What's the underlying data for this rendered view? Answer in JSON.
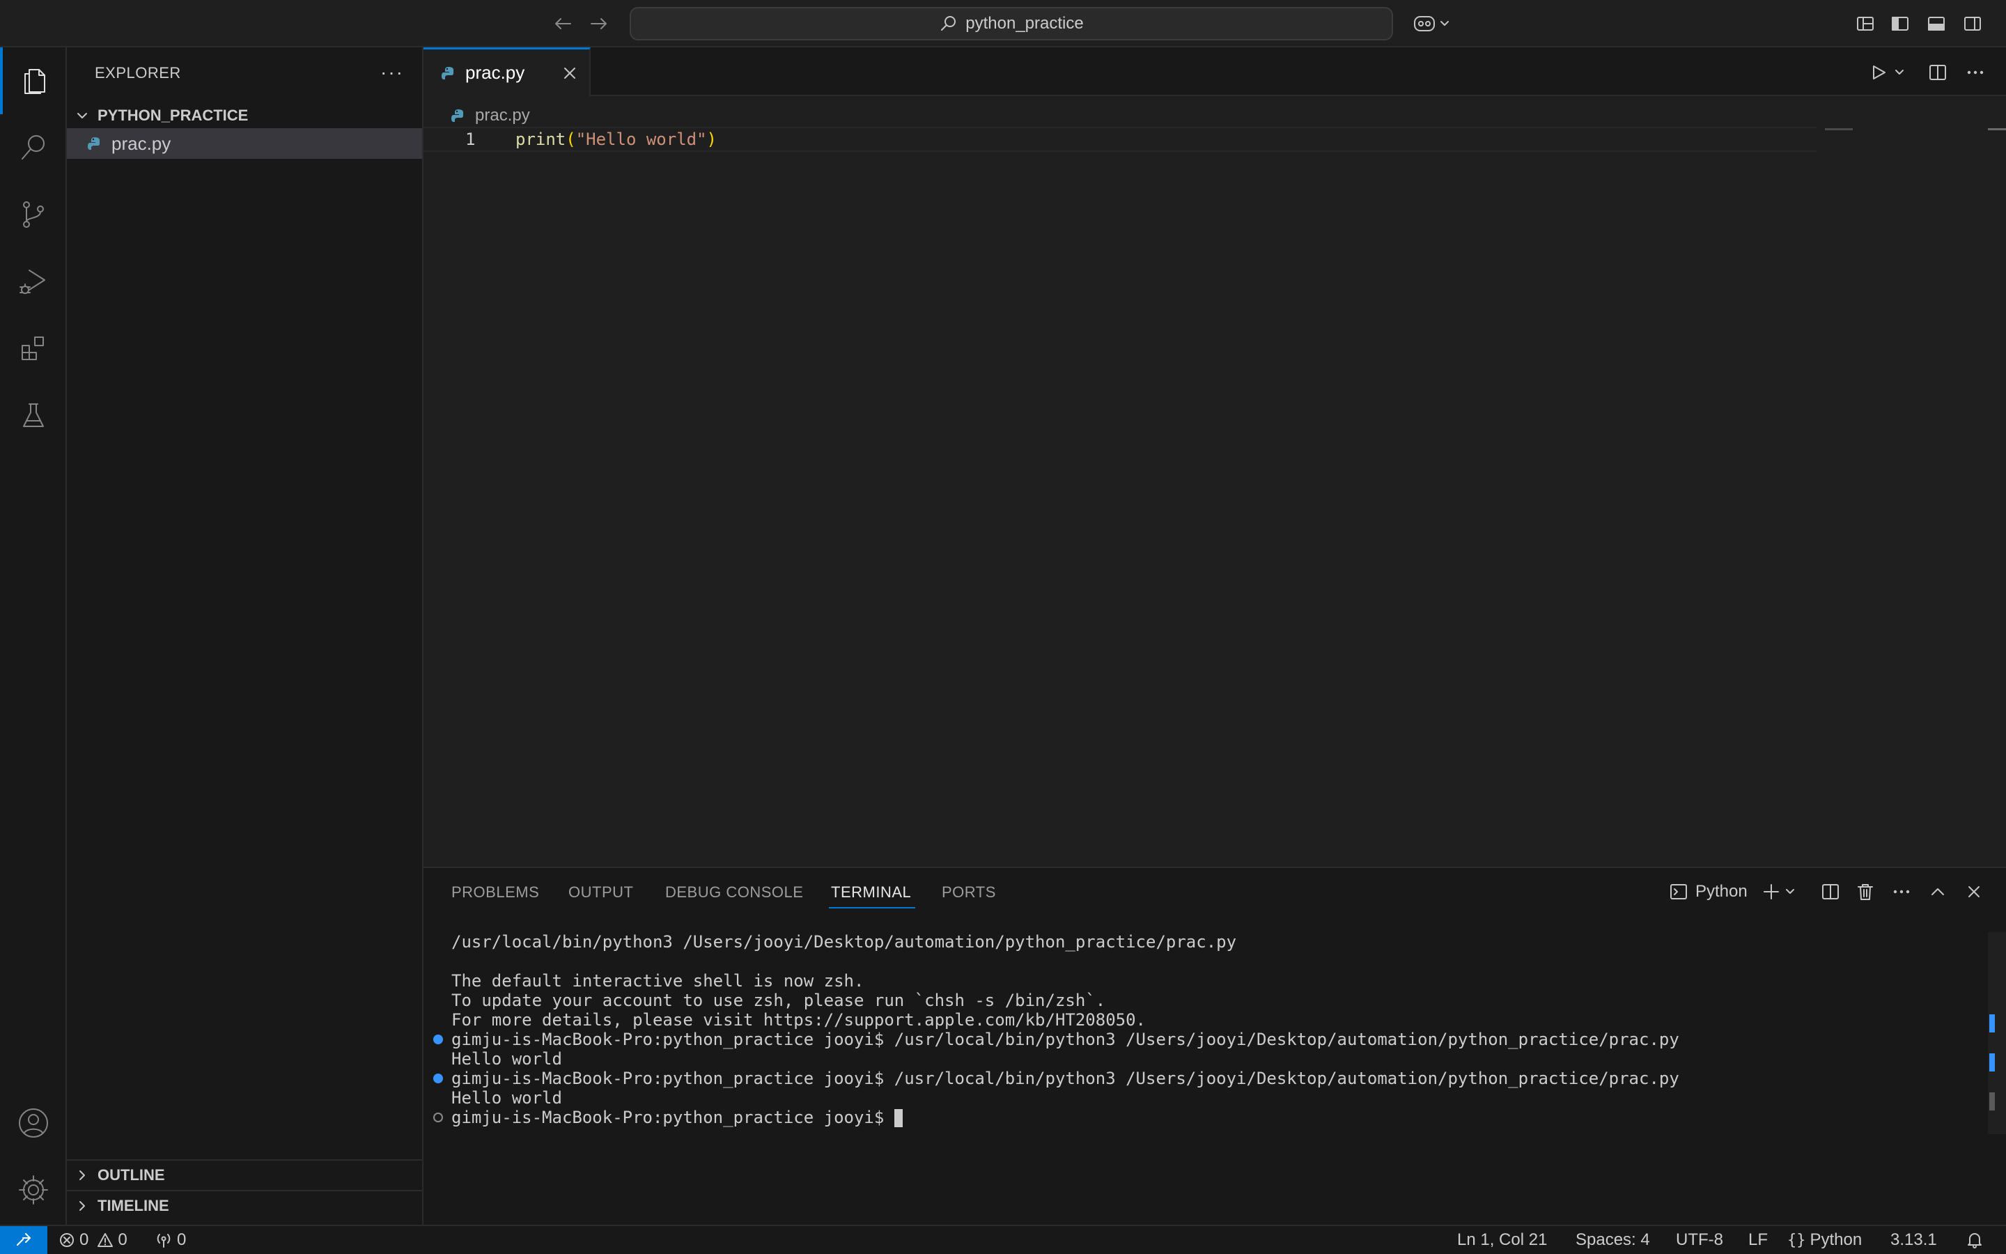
{
  "titlebar": {
    "search_text": "python_practice"
  },
  "sidebar": {
    "title": "EXPLORER",
    "more": "···",
    "folder": "PYTHON_PRACTICE",
    "files": [
      {
        "name": "prac.py"
      }
    ],
    "outline": "OUTLINE",
    "timeline": "TIMELINE"
  },
  "editor": {
    "tab_label": "prac.py",
    "breadcrumb": "prac.py",
    "line_number": "1",
    "code": {
      "fn": "print",
      "open": "(",
      "string": "\"Hello world\"",
      "close": ")"
    }
  },
  "panel": {
    "tabs": [
      "PROBLEMS",
      "OUTPUT",
      "DEBUG CONSOLE",
      "TERMINAL",
      "PORTS"
    ],
    "active_tab": "TERMINAL",
    "terminal_profile": "Python",
    "terminal_lines": [
      "/usr/local/bin/python3 /Users/jooyi/Desktop/automation/python_practice/prac.py",
      "The default interactive shell is now zsh.",
      "To update your account to use zsh, please run `chsh -s /bin/zsh`.",
      "For more details, please visit https://support.apple.com/kb/HT208050.",
      "gimju-is-MacBook-Pro:python_practice jooyi$ /usr/local/bin/python3 /Users/jooyi/Desktop/automation/python_practice/prac.py",
      "Hello world",
      "gimju-is-MacBook-Pro:python_practice jooyi$ /usr/local/bin/python3 /Users/jooyi/Desktop/automation/python_practice/prac.py",
      "Hello world",
      "gimju-is-MacBook-Pro:python_practice jooyi$ "
    ]
  },
  "statusbar": {
    "errors": "0",
    "warnings": "0",
    "ports": "0",
    "position": "Ln 1, Col 21",
    "spaces": "Spaces: 4",
    "encoding": "UTF-8",
    "eol": "LF",
    "language": "Python",
    "interpreter": "3.13.1"
  },
  "colors": {
    "accent": "#0078d4",
    "python_icon": "#519aba",
    "terminal_dot": "#3794ff"
  }
}
